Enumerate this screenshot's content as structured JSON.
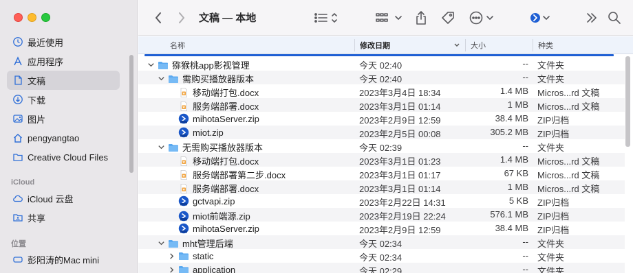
{
  "window": {
    "title": "文稿 — 本地"
  },
  "sidebar": {
    "favorites": [
      {
        "label": "最近使用",
        "icon": "clock-icon"
      },
      {
        "label": "应用程序",
        "icon": "applications-icon"
      },
      {
        "label": "文稿",
        "icon": "document-icon",
        "active": true
      },
      {
        "label": "下载",
        "icon": "download-icon"
      },
      {
        "label": "图片",
        "icon": "photo-icon"
      },
      {
        "label": "pengyangtao",
        "icon": "home-icon"
      },
      {
        "label": "Creative Cloud Files",
        "icon": "folder-icon"
      }
    ],
    "icloud_header": "iCloud",
    "icloud": [
      {
        "label": "iCloud 云盘",
        "icon": "cloud-icon"
      },
      {
        "label": "共享",
        "icon": "shared-folder-icon"
      }
    ],
    "locations_header": "位置",
    "locations": [
      {
        "label": "彭阳涛的Mac mini",
        "icon": "computer-icon"
      }
    ]
  },
  "columns": {
    "name": "名称",
    "date": "修改日期",
    "size": "大小",
    "kind": "种类"
  },
  "rows": [
    {
      "level": 0,
      "disclosure": "open",
      "type": "folder",
      "name": "猕猴桃app影视管理",
      "date": "今天 02:40",
      "size": "--",
      "kind": "文件夹"
    },
    {
      "level": 1,
      "disclosure": "open",
      "type": "folder",
      "name": "需购买播放器版本",
      "date": "今天 02:40",
      "size": "--",
      "kind": "文件夹"
    },
    {
      "level": 2,
      "disclosure": "none",
      "type": "docx",
      "name": "移动端打包.docx",
      "date": "2023年3月4日 18:34",
      "size": "1.4 MB",
      "kind": "Micros...rd 文稿"
    },
    {
      "level": 2,
      "disclosure": "none",
      "type": "docx",
      "name": "服务端部署.docx",
      "date": "2023年3月1日 01:14",
      "size": "1 MB",
      "kind": "Micros...rd 文稿"
    },
    {
      "level": 2,
      "disclosure": "none",
      "type": "zip",
      "name": "mihotaServer.zip",
      "date": "2023年2月9日 12:59",
      "size": "38.4 MB",
      "kind": "ZIP归档"
    },
    {
      "level": 2,
      "disclosure": "none",
      "type": "zip",
      "name": "miot.zip",
      "date": "2023年2月5日 00:08",
      "size": "305.2 MB",
      "kind": "ZIP归档"
    },
    {
      "level": 1,
      "disclosure": "open",
      "type": "folder",
      "name": "无需购买播放器版本",
      "date": "今天 02:39",
      "size": "--",
      "kind": "文件夹"
    },
    {
      "level": 2,
      "disclosure": "none",
      "type": "docx",
      "name": "移动端打包.docx",
      "date": "2023年3月1日 01:23",
      "size": "1.4 MB",
      "kind": "Micros...rd 文稿"
    },
    {
      "level": 2,
      "disclosure": "none",
      "type": "docx",
      "name": "服务端部署第二步.docx",
      "date": "2023年3月1日 01:17",
      "size": "67 KB",
      "kind": "Micros...rd 文稿"
    },
    {
      "level": 2,
      "disclosure": "none",
      "type": "docx",
      "name": "服务端部署.docx",
      "date": "2023年3月1日 01:14",
      "size": "1 MB",
      "kind": "Micros...rd 文稿"
    },
    {
      "level": 2,
      "disclosure": "none",
      "type": "zip",
      "name": "gctvapi.zip",
      "date": "2023年2月22日 14:31",
      "size": "5 KB",
      "kind": "ZIP归档"
    },
    {
      "level": 2,
      "disclosure": "none",
      "type": "zip",
      "name": "miot前端源.zip",
      "date": "2023年2月19日 22:24",
      "size": "576.1 MB",
      "kind": "ZIP归档"
    },
    {
      "level": 2,
      "disclosure": "none",
      "type": "zip",
      "name": "mihotaServer.zip",
      "date": "2023年2月9日 12:59",
      "size": "38.4 MB",
      "kind": "ZIP归档"
    },
    {
      "level": 1,
      "disclosure": "open",
      "type": "folder",
      "name": "mht管理后端",
      "date": "今天 02:34",
      "size": "--",
      "kind": "文件夹"
    },
    {
      "level": 2,
      "disclosure": "closed",
      "type": "folder",
      "name": "static",
      "date": "今天 02:34",
      "size": "--",
      "kind": "文件夹"
    },
    {
      "level": 2,
      "disclosure": "closed",
      "type": "folder",
      "name": "application",
      "date": "今天 02:29",
      "size": "--",
      "kind": "文件夹"
    }
  ],
  "colors": {
    "accent": "#1f5fd4",
    "folder": "#5aa9f0",
    "selected_sidebar": "#d6d4d9",
    "docx_icon": "#f0a13a"
  }
}
